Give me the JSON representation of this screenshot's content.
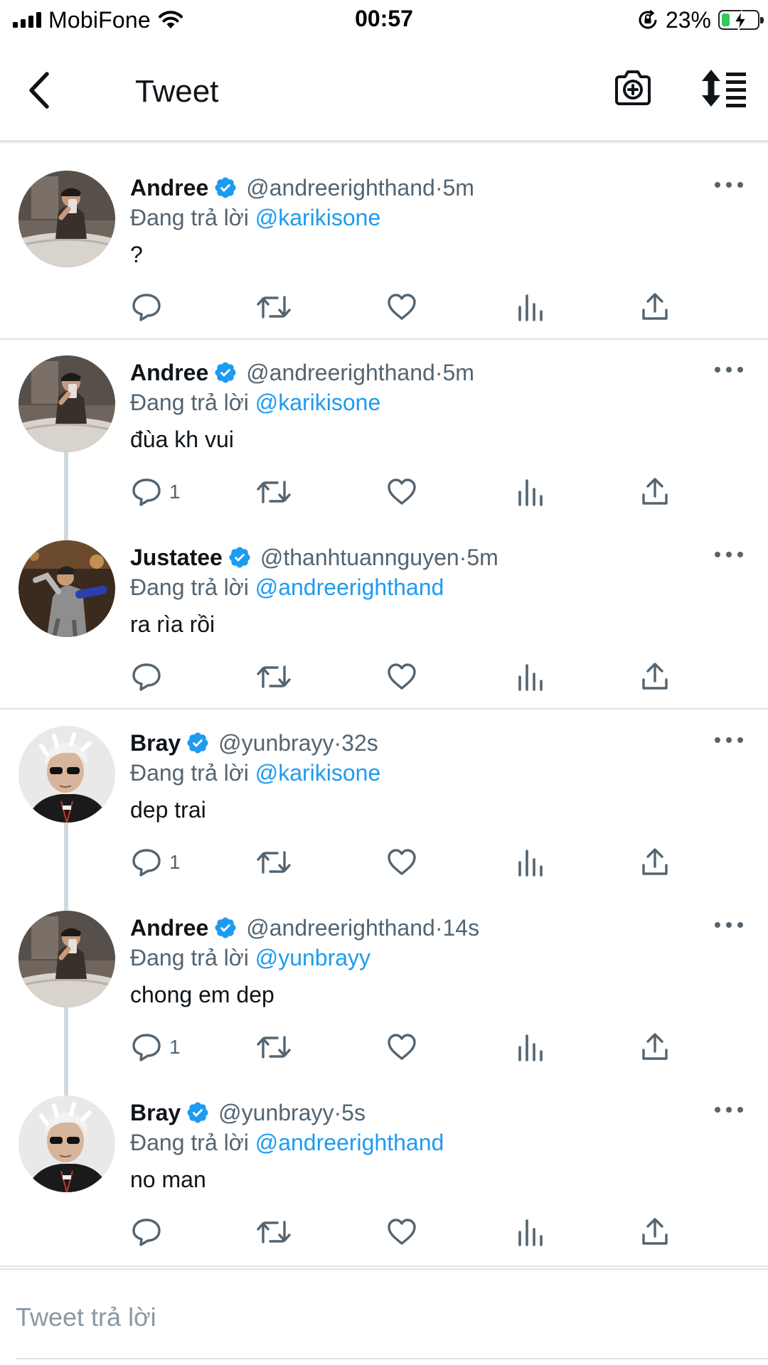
{
  "status_bar": {
    "carrier": "MobiFone",
    "time": "00:57",
    "battery_percent": "23%",
    "battery_level": 0.23,
    "battery_color": "#34c759"
  },
  "header": {
    "title": "Tweet",
    "back_icon": "chevron-left-icon",
    "camera_icon": "camera-plus-icon",
    "sort_icon": "sort-list-icon"
  },
  "colors": {
    "accent": "#1d9bf0",
    "secondary_text": "#536471",
    "divider": "#e1e4e6",
    "thread_line": "#cfd9de"
  },
  "tweets": [
    {
      "name": "Andree",
      "handle": "@andreerighthand",
      "sep": " · ",
      "time": "5m",
      "reply_prefix": "Đang trả lời ",
      "reply_to": "@karikisone",
      "text": "?",
      "reply_count": "",
      "avatar": "andree-avatar"
    },
    {
      "name": "Andree",
      "handle": "@andreerighthand",
      "sep": " · ",
      "time": "5m",
      "reply_prefix": "Đang trả lời ",
      "reply_to": "@karikisone",
      "text": "đùa kh vui",
      "reply_count": "1",
      "avatar": "andree-avatar"
    },
    {
      "name": "Justatee",
      "handle": "@thanhtuannguyen",
      "sep": " · ",
      "time": "5m",
      "reply_prefix": "Đang trả lời ",
      "reply_to": "@andreerighthand",
      "text": "ra rìa rồi",
      "reply_count": "",
      "avatar": "justatee-avatar"
    },
    {
      "name": "Bray",
      "handle": "@yunbrayy",
      "sep": " · ",
      "time": "32s",
      "reply_prefix": "Đang trả lời ",
      "reply_to": "@karikisone",
      "text": "dep trai",
      "reply_count": "1",
      "avatar": "bray-avatar"
    },
    {
      "name": "Andree",
      "handle": "@andreerighthand",
      "sep": " · ",
      "time": "14s",
      "reply_prefix": "Đang trả lời ",
      "reply_to": "@yunbrayy",
      "text": "chong em dep",
      "reply_count": "1",
      "avatar": "andree-avatar"
    },
    {
      "name": "Bray",
      "handle": "@yunbrayy",
      "sep": " · ",
      "time": "5s",
      "reply_prefix": "Đang trả lời ",
      "reply_to": "@andreerighthand",
      "text": "no man",
      "reply_count": "",
      "avatar": "bray-avatar"
    }
  ],
  "reply_box": {
    "placeholder": "Tweet trả lời"
  }
}
